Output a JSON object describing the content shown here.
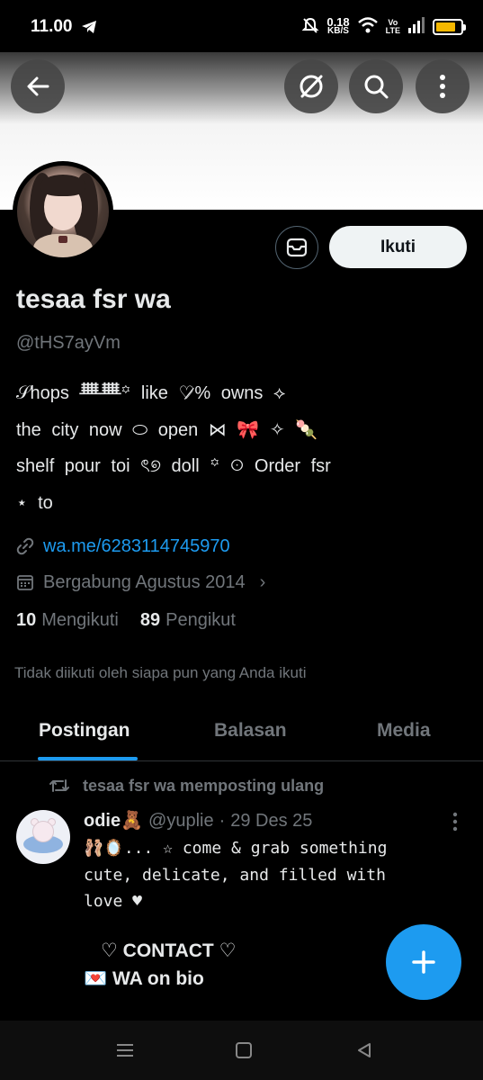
{
  "status_bar": {
    "time": "11.00",
    "network_speed_value": "0.18",
    "network_speed_unit": "KB/S",
    "volte_top": "Vo",
    "volte_bottom": "LTE",
    "battery_level": 0.8,
    "battery_color": "#f5b800"
  },
  "header": {
    "back_icon": "arrow-left-icon",
    "grok_icon": "grok-icon",
    "search_icon": "search-icon",
    "more_icon": "more-vertical-icon"
  },
  "profile": {
    "name": "tesaa fsr wa",
    "handle": "@tHS7ayVm",
    "follow_label": "Ikuti",
    "bio_lines": [
      "𝒮hops ᚙᚙ꙳  like ♡̷% owns ⟡",
      "the city now ⬭ open ⋈ 🎀        ✧ 🍡",
      "  shelf pour toi ৎ୭ doll ꙳       ꖴ Order fsr",
      "⋆ to"
    ],
    "website": "wa.me/6283114745970",
    "joined": "Bergabung Agustus 2014",
    "following_count": "10",
    "following_label": "Mengikuti",
    "followers_count": "89",
    "followers_label": "Pengikut",
    "not_followed_note": "Tidak diikuti oleh siapa pun yang Anda ikuti"
  },
  "tabs": [
    {
      "label": "Postingan",
      "active": true
    },
    {
      "label": "Balasan",
      "active": false
    },
    {
      "label": "Media",
      "active": false
    }
  ],
  "post": {
    "repost_note": "tesaa fsr wa memposting ulang",
    "author": "odie🧸",
    "handle": "@yuplie",
    "separator": "·",
    "date": "29 Des 25",
    "body_lines": [
      "🩰🪞... ☆ come & grab something",
      "cute, delicate, and filled with",
      "love ♥"
    ],
    "contact_line": "♡ CONTACT ♡",
    "wa_line": "💌 WA on bio"
  },
  "colors": {
    "accent": "#1d9bf0",
    "text_primary": "#e7e9ea",
    "text_secondary": "#71767b",
    "background": "#000000"
  }
}
